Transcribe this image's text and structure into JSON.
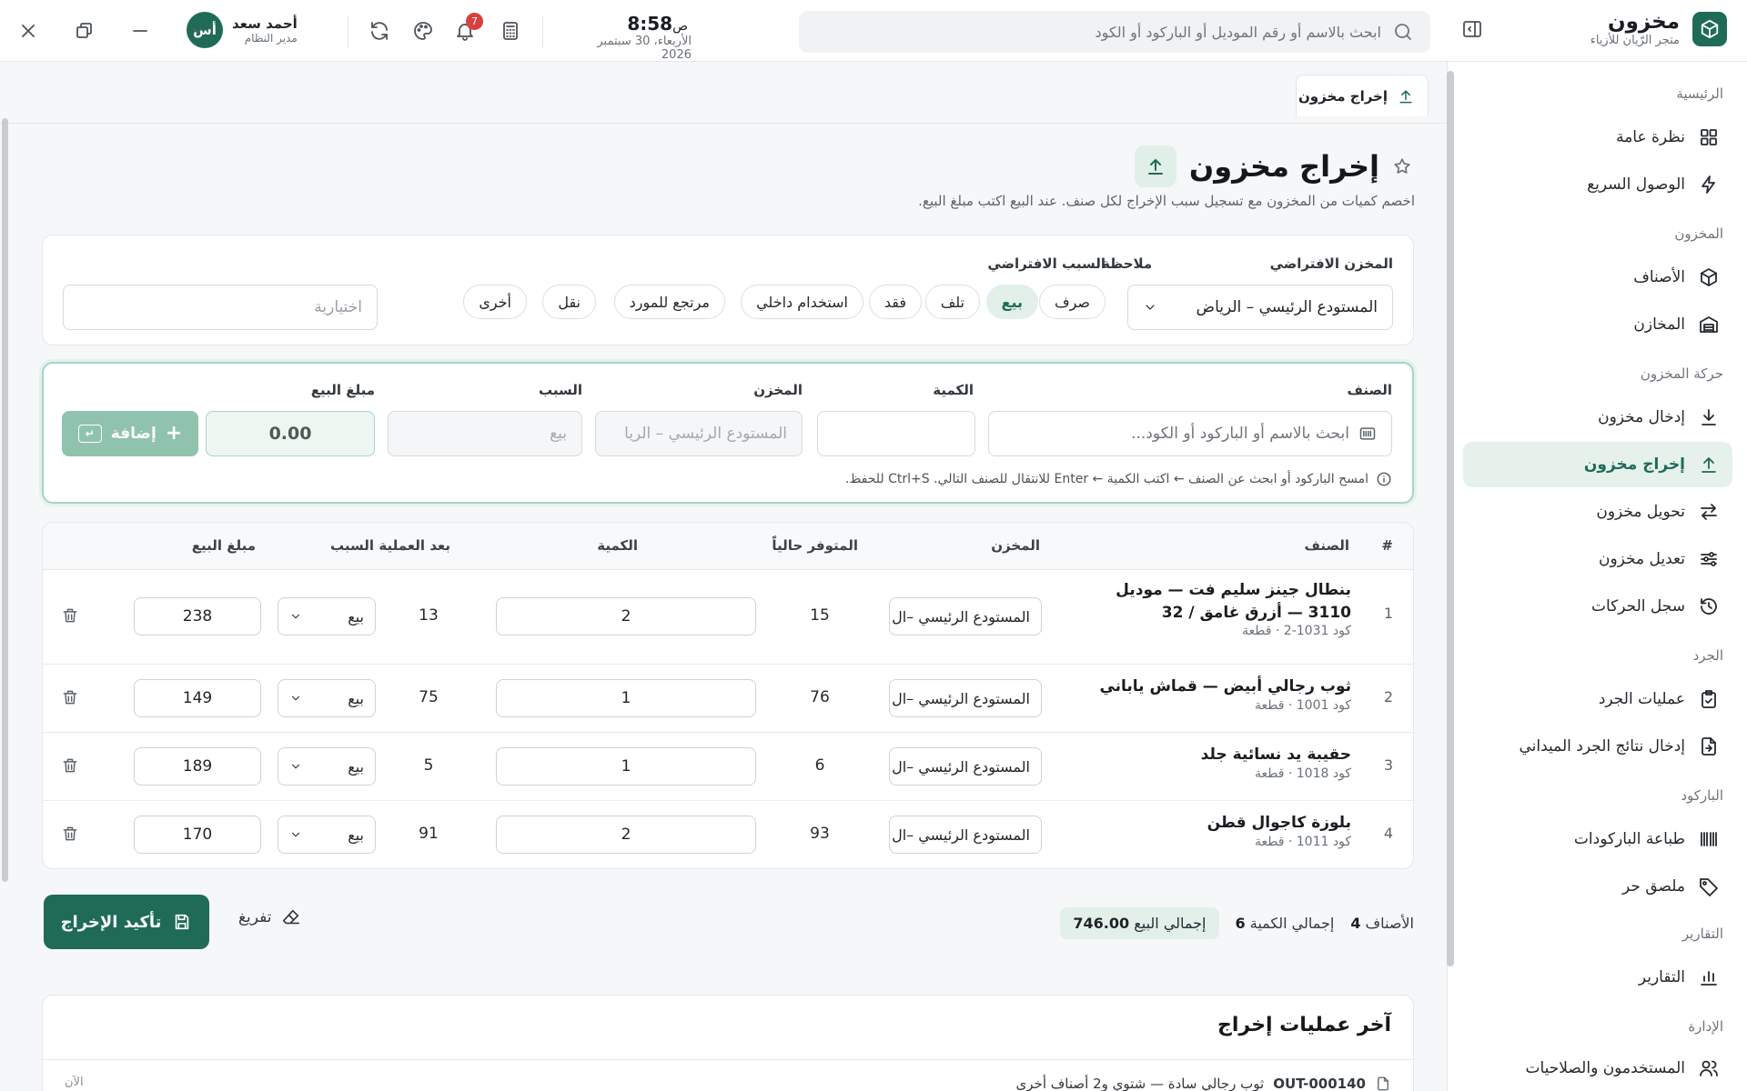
{
  "app": {
    "name": "مخزون",
    "subtitle": "متجر الرّيان للأزياء"
  },
  "search": {
    "placeholder": "ابحث بالاسم أو رقم الموديل أو الباركود أو الكود"
  },
  "clock": {
    "time": "8:58",
    "ampm": "ص",
    "date": "الأربعاء، 30 سبتمبر 2026"
  },
  "notifications": {
    "count": "7"
  },
  "user": {
    "initials": "أس",
    "name": "أحمد سعد",
    "role": "مدير النظام"
  },
  "sidebar": {
    "sections": [
      {
        "title": "الرئيسية"
      },
      {
        "title": "المخزون"
      },
      {
        "title": "حركة المخزون"
      },
      {
        "title": "الجرد"
      },
      {
        "title": "الباركود"
      },
      {
        "title": "التقارير"
      },
      {
        "title": "الإدارة"
      }
    ],
    "items": [
      {
        "label": "نظرة عامة",
        "icon": "grid-icon"
      },
      {
        "label": "الوصول السريع",
        "icon": "bolt-icon"
      },
      {
        "label": "الأصناف",
        "icon": "box-icon"
      },
      {
        "label": "المخازن",
        "icon": "warehouse-icon"
      },
      {
        "label": "إدخال مخزون",
        "icon": "download-icon"
      },
      {
        "label": "إخراج مخزون",
        "icon": "upload-icon"
      },
      {
        "label": "تحويل مخزون",
        "icon": "swap-icon"
      },
      {
        "label": "تعديل مخزون",
        "icon": "sliders-icon"
      },
      {
        "label": "سجل الحركات",
        "icon": "history-icon"
      },
      {
        "label": "عمليات الجرد",
        "icon": "clipboard-icon"
      },
      {
        "label": "إدخال نتائج الجرد الميداني",
        "icon": "file-import-icon"
      },
      {
        "label": "طباعة الباركودات",
        "icon": "barcode-icon"
      },
      {
        "label": "ملصق حر",
        "icon": "tag-icon"
      },
      {
        "label": "التقارير",
        "icon": "chart-icon"
      },
      {
        "label": "المستخدمون والصلاحيات",
        "icon": "users-icon"
      }
    ]
  },
  "tab": {
    "label": "إخراج مخزون"
  },
  "page": {
    "title": "إخراج مخزون",
    "subtitle": "اخصم كميات من المخزون مع تسجيل سبب الإخراج لكل صنف. عند البيع اكتب مبلغ البيع."
  },
  "defaults": {
    "warehouse_label": "المخزن الافتراضي",
    "warehouse_value": "المستودع الرئيسي – الرياض",
    "reason_label": "السبب الافتراضي",
    "reasons": [
      "صرف",
      "بيع",
      "تلف",
      "فقد",
      "استخدام داخلي",
      "مرتجع للمورد",
      "نقل",
      "أخرى"
    ],
    "active_reason": "بيع",
    "note_label": "ملاحظة",
    "note_placeholder": "اختيارية"
  },
  "entry": {
    "item_label": "الصنف",
    "item_placeholder": "ابحث بالاسم أو الباركود أو الكود...",
    "qty_label": "الكمية",
    "warehouse_label": "المخزن",
    "warehouse_value": "المستودع الرئيسي – الريا",
    "reason_label": "السبب",
    "reason_value": "بيع",
    "price_label": "مبلغ البيع",
    "price_value": "0.00",
    "add_label": "إضافة",
    "hint": "امسح الباركود أو ابحث عن الصنف ← اكتب الكمية ← Enter للانتقال للصنف التالي. Ctrl+S للحفظ."
  },
  "table": {
    "columns": [
      "#",
      "الصنف",
      "المخزن",
      "المتوفر حالياً",
      "الكمية",
      "بعد العملية",
      "السبب",
      "مبلغ البيع"
    ],
    "rows": [
      {
        "n": "1",
        "name": "بنطال جينز سليم فت — موديل 3110 — أزرق غامق / 32",
        "meta": "كود 1031-2 · قطعة",
        "warehouse": "المستودع الرئيسي –ال",
        "available": "15",
        "qty": "2",
        "after": "13",
        "reason": "بيع",
        "price": "238"
      },
      {
        "n": "2",
        "name": "ثوب رجالي أبيض — قماش ياباني",
        "meta": "كود 1001 · قطعة",
        "warehouse": "المستودع الرئيسي –ال",
        "available": "76",
        "qty": "1",
        "after": "75",
        "reason": "بيع",
        "price": "149"
      },
      {
        "n": "3",
        "name": "حقيبة يد نسائية جلد",
        "meta": "كود 1018 · قطعة",
        "warehouse": "المستودع الرئيسي –ال",
        "available": "6",
        "qty": "1",
        "after": "5",
        "reason": "بيع",
        "price": "189"
      },
      {
        "n": "4",
        "name": "بلوزة كاجوال قطن",
        "meta": "كود 1011 · قطعة",
        "warehouse": "المستودع الرئيسي –ال",
        "available": "93",
        "qty": "2",
        "after": "91",
        "reason": "بيع",
        "price": "170"
      }
    ]
  },
  "summary": {
    "items_label": "الأصناف",
    "items_value": "4",
    "qty_label": "إجمالي الكمية",
    "qty_value": "6",
    "total_label": "إجمالي البيع",
    "total_value": "746.00"
  },
  "actions": {
    "confirm": "تأكيد الإخراج",
    "clear": "تفريغ"
  },
  "recent": {
    "title": "آخر عمليات إخراج",
    "first_code": "OUT-000140",
    "first_text": "ثوب رجالي سادة — شتوي و2 أصناف أخرى",
    "first_time": "الآن"
  },
  "colors": {
    "accent": "#1f6b57",
    "accent_light": "#e3f0ea",
    "badge": "#d93f3f"
  }
}
